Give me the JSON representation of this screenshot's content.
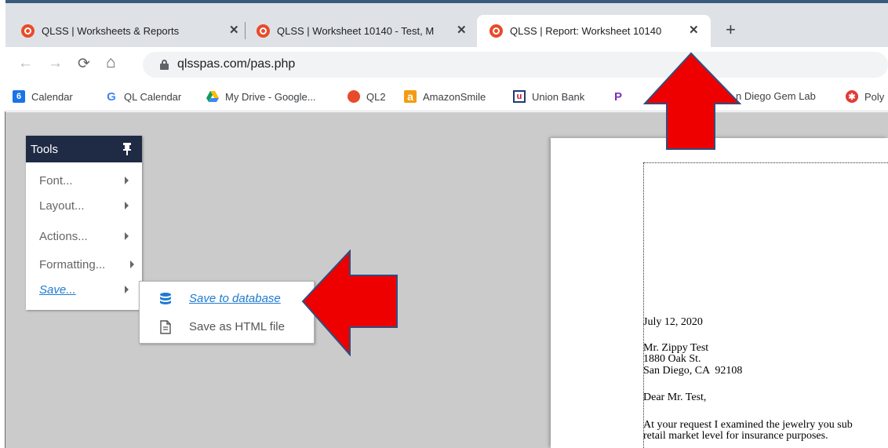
{
  "browser": {
    "tabs": [
      {
        "title": "QLSS | Worksheets & Reports",
        "active": false
      },
      {
        "title": "QLSS | Worksheet 10140 - Test, M",
        "active": false
      },
      {
        "title": "QLSS | Report: Worksheet 10140",
        "active": true
      }
    ],
    "new_tab_label": "+",
    "url": "qlsspas.com/pas.php",
    "bookmarks": [
      {
        "label": "Calendar",
        "icon": "google-calendar-icon"
      },
      {
        "label": "QL Calendar",
        "icon": "google-icon"
      },
      {
        "label": "My Drive - Google...",
        "icon": "google-drive-icon"
      },
      {
        "label": "QL2",
        "icon": "qlss-icon"
      },
      {
        "label": "AmazonSmile",
        "icon": "amazon-icon"
      },
      {
        "label": "Union Bank",
        "icon": "union-bank-icon"
      },
      {
        "label": "P",
        "icon": "paypal-icon"
      },
      {
        "label": "n Diego Gem Lab",
        "icon": "site-icon"
      },
      {
        "label": "Poly",
        "icon": "poly-icon"
      }
    ],
    "calendar_badge": "6"
  },
  "tools_panel": {
    "title": "Tools",
    "items": [
      {
        "label": "Font..."
      },
      {
        "label": "Layout..."
      },
      {
        "label": "Actions..."
      },
      {
        "label": "Formatting..."
      },
      {
        "label": "Save..."
      }
    ],
    "save_submenu": [
      {
        "label": "Save to database",
        "icon": "database-icon"
      },
      {
        "label": "Save as HTML file",
        "icon": "document-icon"
      }
    ]
  },
  "document": {
    "date": "July 12, 2020",
    "address": [
      "Mr. Zippy Test",
      "1880 Oak St.",
      "San Diego, CA  92108"
    ],
    "salutation": "Dear Mr. Test,",
    "body": [
      "At your request I examined the jewelry you sub",
      "retail market level for insurance purposes."
    ]
  },
  "colors": {
    "tools_header": "#1f2a44",
    "link_blue": "#1f7ad1",
    "annotation_red": "#ee0000",
    "annotation_border": "#2f4f7f",
    "workspace_gray": "#cbcbcb"
  }
}
